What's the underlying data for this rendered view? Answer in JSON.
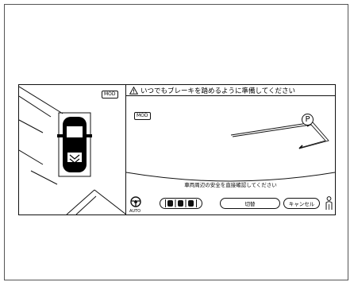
{
  "left_view": {
    "mode_tag": "MOD"
  },
  "camera_view": {
    "warning": "いつでもブレーキを踏めるように準備してください",
    "mode_tag": "MOD",
    "parking_marker": "P",
    "safety_notice": "車両周辺の安全を直接確認してください"
  },
  "controls": {
    "auto_label": "AUTO",
    "parking_type_icon": "parking-type-icon",
    "switch_label": "切替",
    "cancel_label": "キャンセル"
  }
}
